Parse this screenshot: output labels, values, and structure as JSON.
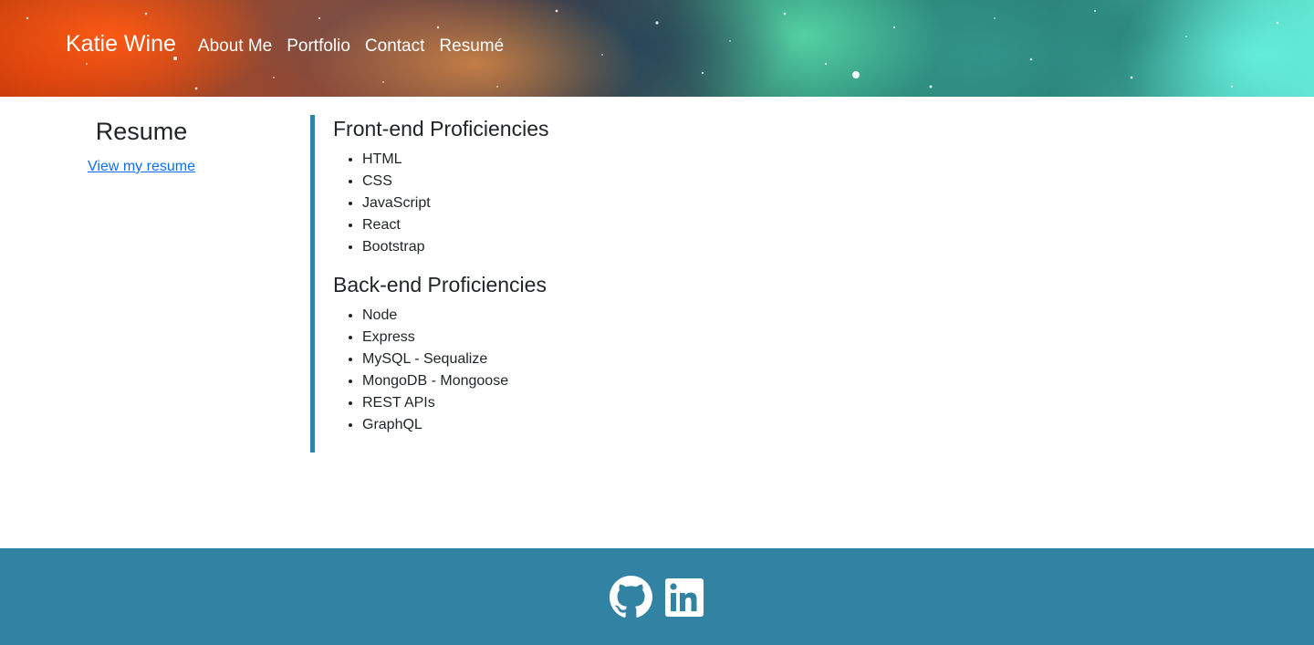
{
  "header": {
    "brand": "Katie Wine",
    "nav_items": [
      {
        "label": "About Me"
      },
      {
        "label": "Portfolio"
      },
      {
        "label": "Contact"
      },
      {
        "label": "Resumé"
      }
    ]
  },
  "sidebar": {
    "title": "Resume",
    "link_label": "View my resume"
  },
  "content": {
    "sections": [
      {
        "heading": "Front-end Proficiencies",
        "items": [
          "HTML",
          "CSS",
          "JavaScript",
          "React",
          "Bootstrap"
        ]
      },
      {
        "heading": "Back-end Proficiencies",
        "items": [
          "Node",
          "Express",
          "MySQL - Sequalize",
          "MongoDB - Mongoose",
          "REST APIs",
          "GraphQL"
        ]
      }
    ]
  },
  "footer": {
    "icons": [
      "github-icon",
      "linkedin-icon"
    ],
    "background_color": "#3182a3"
  },
  "colors": {
    "accent": "#3182a3",
    "link": "#0d6efd",
    "text": "#212529"
  }
}
